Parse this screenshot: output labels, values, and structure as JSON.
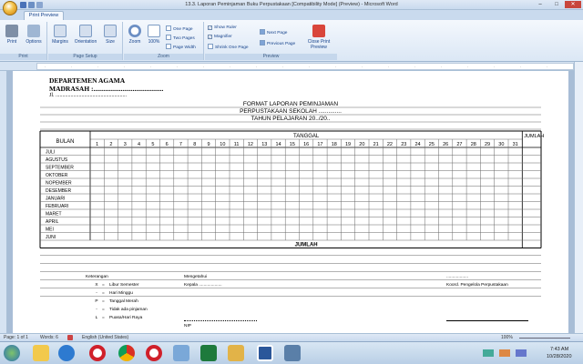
{
  "window": {
    "title": "13.3. Laporan Peminjaman Buku Perpustakaan [Compatibility Mode] (Preview) - Microsoft Word"
  },
  "tabs": {
    "active": "Print Preview"
  },
  "ribbon": {
    "print": {
      "print": "Print",
      "options": "Options",
      "group": "Print"
    },
    "page_setup": {
      "margins": "Margins",
      "orientation": "Orientation",
      "size": "Size",
      "group": "Page Setup"
    },
    "zoom": {
      "zoom": "Zoom",
      "percent": "100%",
      "one_page": "One Page",
      "two_pages": "Two Pages",
      "page_width": "Page Width",
      "group": "Zoom"
    },
    "preview": {
      "show_ruler": "Show Ruler",
      "magnifier": "Magnifier",
      "shrink_one_page": "Shrink One Page",
      "next_page": "Next Page",
      "previous_page": "Previous Page",
      "close_print_preview": "Close Print Preview",
      "group": "Preview"
    }
  },
  "document": {
    "header_line1": "DEPARTEMEN AGAMA",
    "header_line2": "MADRASAH :.........................................",
    "header_line3": "Jl. ....................................................",
    "title1": "FORMAT LAPORAN PEMINJAMAN",
    "title2": "PERPUSTAKAAN SEKOLAH ..............",
    "title3": "TAHUN PELAJARAN 20../20..",
    "col_bulan": "BULAN",
    "col_tanggal": "TANGGAL",
    "col_jumlah": "JUMLAH",
    "days": [
      "1",
      "2",
      "3",
      "4",
      "5",
      "6",
      "7",
      "8",
      "9",
      "10",
      "11",
      "12",
      "13",
      "14",
      "15",
      "16",
      "17",
      "18",
      "19",
      "20",
      "21",
      "22",
      "23",
      "24",
      "25",
      "26",
      "27",
      "28",
      "29",
      "30",
      "31"
    ],
    "months": [
      "JULI",
      "AGUSTUS",
      "SEPTEMBER",
      "OKTOBER",
      "NOPEMBER",
      "DESEMBER",
      "JANUARI",
      "FEBRUARI",
      "MARET",
      "APRIL",
      "MEI",
      "JUNI"
    ],
    "total_label": "JUMLAH",
    "legend_title": "Keterangan",
    "legend": [
      {
        "sym": "X",
        "eq": "=",
        "text": "Libur Semester"
      },
      {
        "sym": "-",
        "eq": "=",
        "text": "Hari Minggu"
      },
      {
        "sym": "P",
        "eq": "=",
        "text": "Tanggal Merah"
      },
      {
        "sym": "-",
        "eq": "=",
        "text": "Tidak ada pinjaman"
      },
      {
        "sym": "L",
        "eq": "=",
        "text": "Puasa/Hari Raya"
      }
    ],
    "mengetahui": "Mengetahui",
    "kepala": "Kepala ...................",
    "nip": "NIP",
    "pengelola": "Koord. Pengelola Perpustakaan",
    "dots_right": ".................."
  },
  "status": {
    "page": "Page: 1 of 1",
    "words": "Words: 6",
    "language": "English (United States)",
    "zoom": "100%"
  },
  "taskbar": {
    "time": "7:43 AM",
    "date": "10/28/2020"
  }
}
